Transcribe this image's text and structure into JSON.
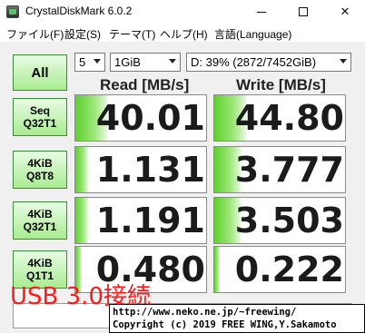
{
  "window": {
    "title": "CrystalDiskMark 6.0.2",
    "minimize_glyph": "minimize-icon",
    "maximize_glyph": "maximize-icon",
    "close_glyph": "✕"
  },
  "menu": [
    {
      "label": "ファイル(F)"
    },
    {
      "label": "設定(S)"
    },
    {
      "label": "テーマ(T)"
    },
    {
      "label": "ヘルプ(H)"
    },
    {
      "label": "言語(Language)"
    }
  ],
  "controls": {
    "all_label": "All",
    "test_count": "5",
    "test_size": "1GiB",
    "drive": "D: 39% (2872/7452GiB)"
  },
  "headers": {
    "read": "Read [MB/s]",
    "write": "Write [MB/s]"
  },
  "tests": [
    {
      "line1": "Seq",
      "line2": "Q32T1",
      "read": "40.01",
      "write": "44.80",
      "read_fill": 0.24,
      "write_fill": 0.24
    },
    {
      "line1": "4KiB",
      "line2": "Q8T8",
      "read": "1.131",
      "write": "3.777",
      "read_fill": 0.1,
      "write_fill": 0.2
    },
    {
      "line1": "4KiB",
      "line2": "Q32T1",
      "read": "1.191",
      "write": "3.503",
      "read_fill": 0.1,
      "write_fill": 0.2
    },
    {
      "line1": "4KiB",
      "line2": "Q1T1",
      "read": "0.480",
      "write": "0.222",
      "read_fill": 0.05,
      "write_fill": 0.04
    }
  ],
  "overlay_label": "USB 3.0接続",
  "copyright": {
    "line1": "http://www.neko.ne.jp/~freewing/",
    "line2": "Copyright (c) 2019 FREE WING,Y.Sakamoto"
  },
  "colors": {
    "bar_green": "#5cd12b",
    "overlay_red": "#ff1a1a"
  }
}
